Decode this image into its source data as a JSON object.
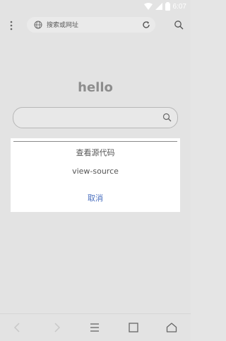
{
  "status_bar": {
    "time": "6:07"
  },
  "toolbar": {
    "url_placeholder": "搜索或网址"
  },
  "page": {
    "heading": "hello"
  },
  "dialog": {
    "title": "查看源代码",
    "item": "view-source",
    "cancel_label": "取消"
  },
  "colors": {
    "accent": "#4a6fbf",
    "background": "#e3e3e3",
    "dialog_bg": "#ffffff"
  }
}
